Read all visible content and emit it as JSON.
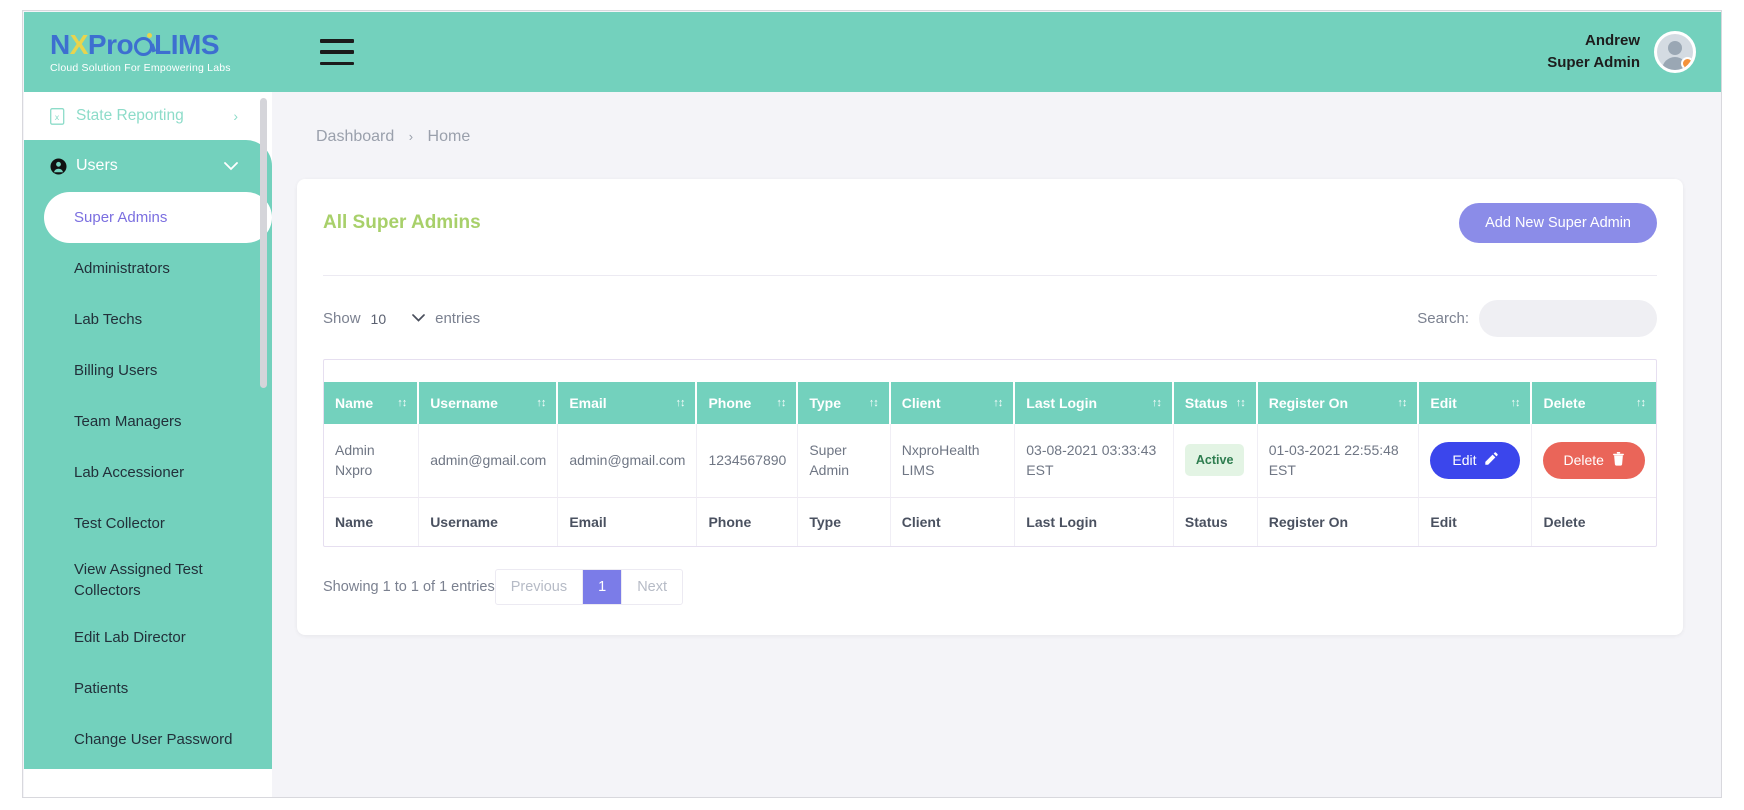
{
  "header": {
    "logo": {
      "nx": "N",
      "x": "X",
      "pro": "Pro",
      "lims": "LIMS",
      "tagline": "Cloud Solution For Empowering Labs"
    },
    "menu_icon": "hamburger-icon",
    "user": {
      "name": "Andrew",
      "role": "Super Admin"
    }
  },
  "sidebar": {
    "top_item": {
      "label": "State Reporting",
      "icon": "report-file-icon",
      "chevron": "›"
    },
    "group": {
      "label": "Users",
      "icon": "user-circle-icon",
      "chevron": "⌄"
    },
    "items": [
      {
        "label": "Super Admins",
        "active": true
      },
      {
        "label": "Administrators",
        "active": false
      },
      {
        "label": "Lab Techs",
        "active": false
      },
      {
        "label": "Billing Users",
        "active": false
      },
      {
        "label": "Team Managers",
        "active": false
      },
      {
        "label": "Lab Accessioner",
        "active": false
      },
      {
        "label": "Test Collector",
        "active": false
      },
      {
        "label": "View Assigned Test Collectors",
        "active": false
      },
      {
        "label": "Edit Lab Director",
        "active": false
      },
      {
        "label": "Patients",
        "active": false
      },
      {
        "label": "Change User Password",
        "active": false
      }
    ]
  },
  "breadcrumb": {
    "root": "Dashboard",
    "separator": "›",
    "current": "Home"
  },
  "card": {
    "title": "All Super Admins",
    "add_button": "Add New Super Admin"
  },
  "controls": {
    "show_label": "Show",
    "entries_value": "10",
    "entries_label": "entries",
    "search_label": "Search:",
    "search_value": "",
    "search_placeholder": ""
  },
  "table": {
    "columns": [
      "Name",
      "Username",
      "Email",
      "Phone",
      "Type",
      "Client",
      "Last Login",
      "Status",
      "Register On",
      "Edit",
      "Delete"
    ],
    "sort_icon": "↑↕",
    "rows": [
      {
        "name": "Admin Nxpro",
        "username": "admin@gmail.com",
        "email": "admin@gmail.com",
        "phone": "1234567890",
        "type": "Super Admin",
        "client": "NxproHealth LIMS",
        "last_login": "03-08-2021 03:33:43 EST",
        "status": "Active",
        "register_on": "01-03-2021 22:55:48 EST",
        "edit_label": "Edit",
        "edit_icon": "pencil-square-icon",
        "delete_label": "Delete",
        "delete_icon": "trash-icon"
      }
    ],
    "footer_columns": [
      "Name",
      "Username",
      "Email",
      "Phone",
      "Type",
      "Client",
      "Last Login",
      "Status",
      "Register On",
      "Edit",
      "Delete"
    ]
  },
  "pagination": {
    "showing": "Showing 1 to 1 of 1 entries",
    "previous": "Previous",
    "current_page": "1",
    "next": "Next"
  },
  "colors": {
    "brand_teal": "#73d1bd",
    "accent_purple": "#8b8ce8",
    "title_green": "#a8d06a",
    "edit_blue": "#3b46ec",
    "delete_red": "#ea6559",
    "status_green": "#2e7d4f"
  }
}
